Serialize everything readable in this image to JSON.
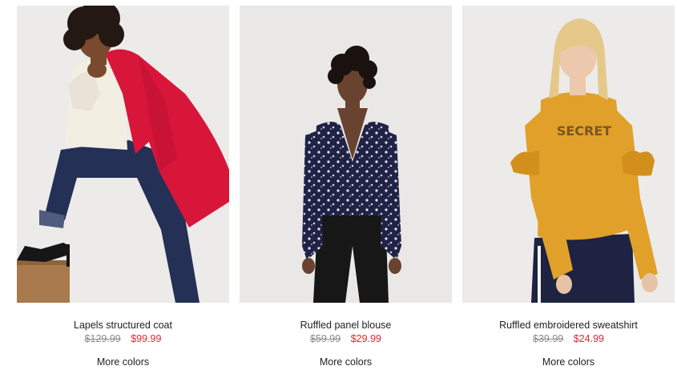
{
  "products": [
    {
      "name": "Lapels structured coat",
      "old_price": "$129.99",
      "sale_price": "$99.99",
      "more_colors": "More colors",
      "image_subject": "model wearing red structured coat, cream sweater, dark jeans, black heels",
      "garment_color": "#d8163a"
    },
    {
      "name": "Ruffled panel blouse",
      "old_price": "$59.99",
      "sale_price": "$29.99",
      "more_colors": "More colors",
      "image_subject": "model wearing navy floral print blouse and black jeans",
      "garment_color": "#1f2346"
    },
    {
      "name": "Ruffled embroidered sweatshirt",
      "old_price": "$39.99",
      "sale_price": "$24.99",
      "more_colors": "More colors",
      "image_subject": "model wearing mustard ruffled sweatshirt and navy trousers",
      "garment_color": "#e0a02a",
      "garment_text": "SECRET"
    }
  ],
  "colors": {
    "sale": "#e0262f",
    "old_price": "#8a8a8a",
    "photo_background": "#ebebea"
  }
}
